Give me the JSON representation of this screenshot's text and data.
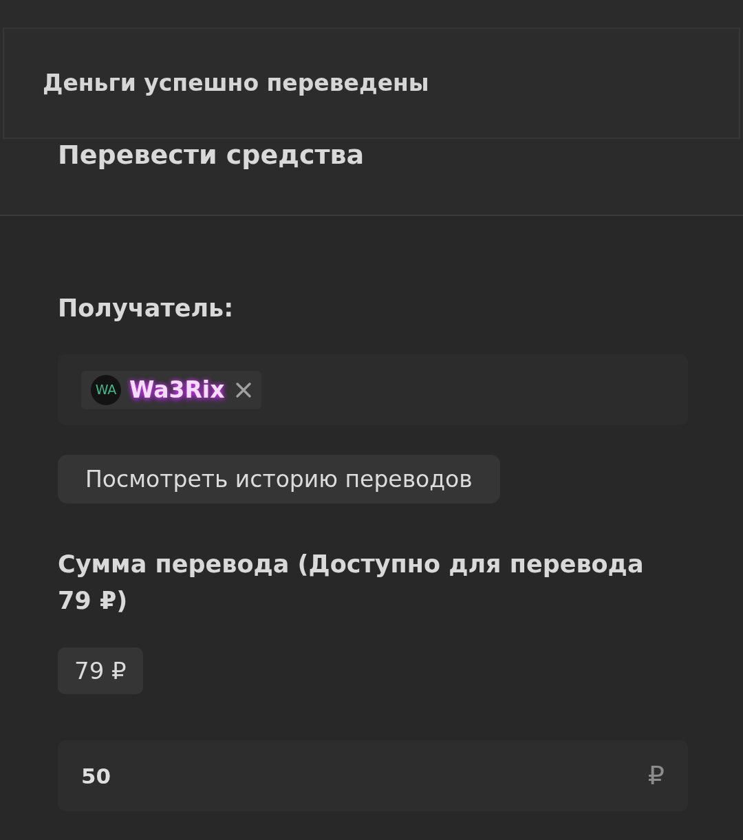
{
  "toast": {
    "message": "Деньги успешно переведены"
  },
  "header": {
    "title": "Перевести средства"
  },
  "recipient": {
    "label": "Получатель:",
    "chips": [
      {
        "initials": "WA",
        "name": "Wa3Rix"
      }
    ]
  },
  "history_button": {
    "label": "Посмотреть историю переводов"
  },
  "amount": {
    "label": "Сумма перевода (Доступно для перевода 79 ₽)",
    "presets": [
      "79 ₽"
    ],
    "value": "50",
    "currency": "₽"
  }
}
